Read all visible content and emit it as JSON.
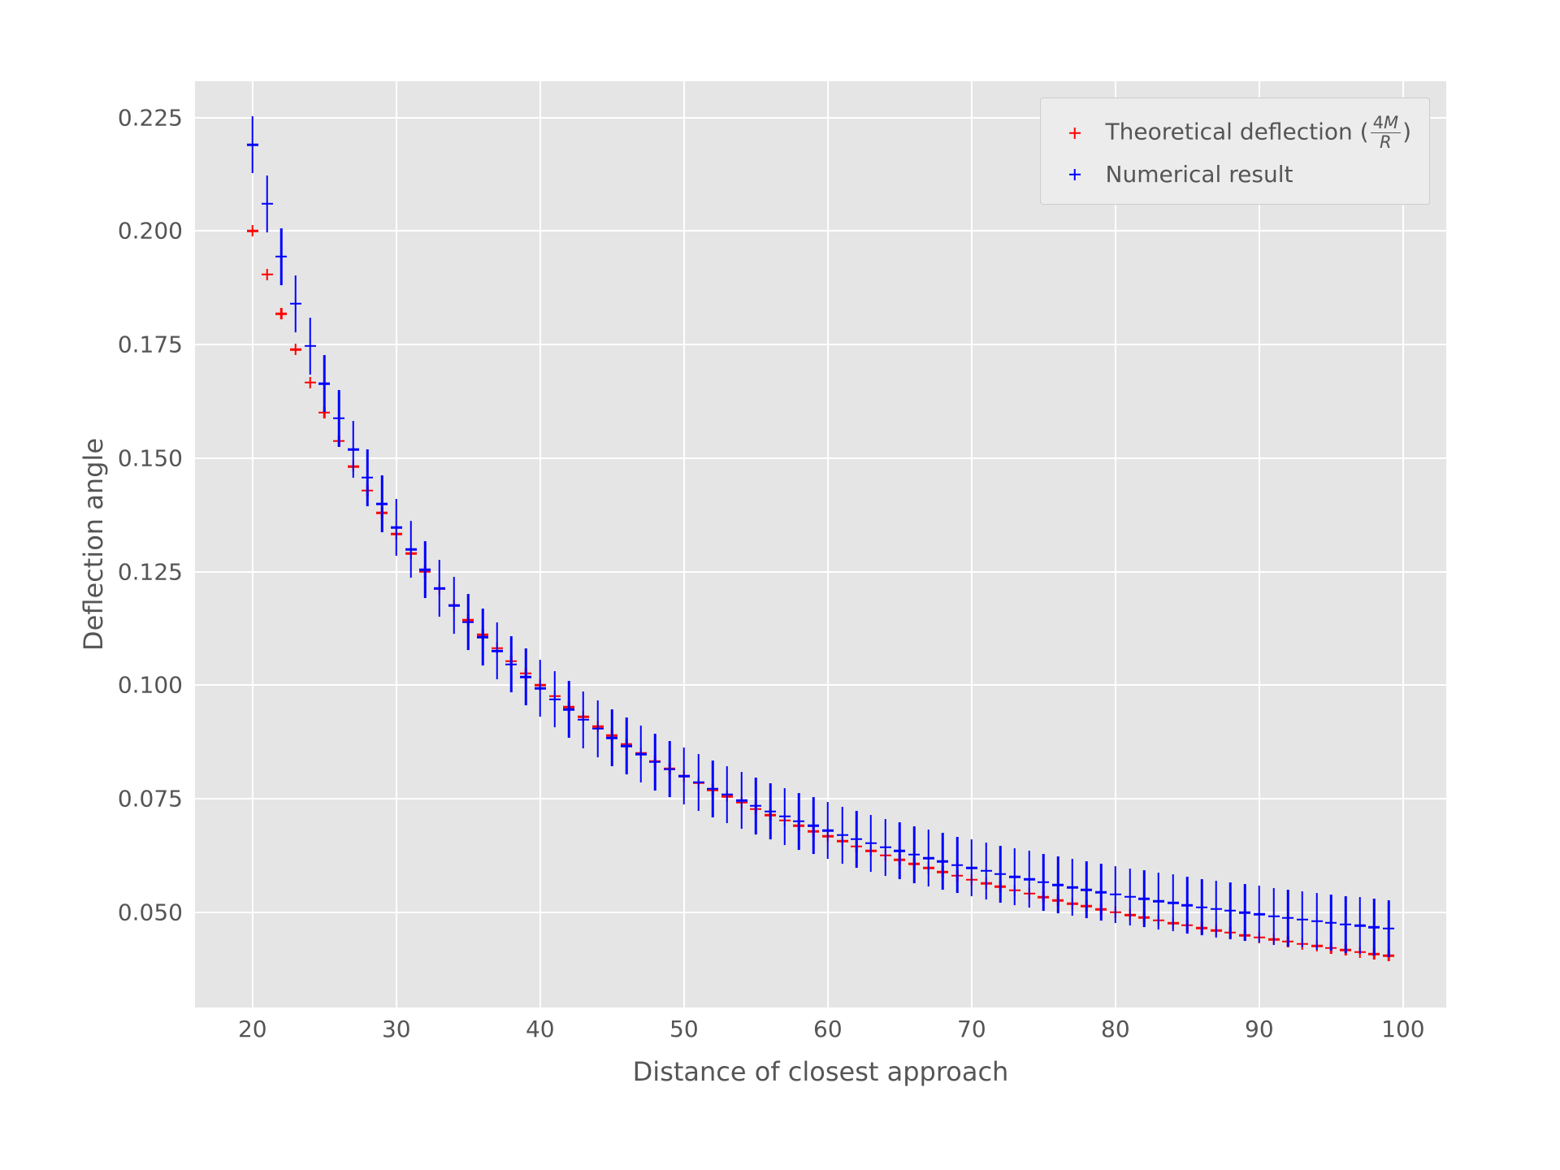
{
  "chart_data": {
    "type": "scatter",
    "xlabel": "Distance of closest approach",
    "ylabel": "Deflection angle",
    "xlim": [
      16,
      103
    ],
    "ylim": [
      0.029,
      0.233
    ],
    "xticks": [
      20,
      30,
      40,
      50,
      60,
      70,
      80,
      90,
      100
    ],
    "yticks": [
      0.05,
      0.075,
      0.1,
      0.125,
      0.15,
      0.175,
      0.2,
      0.225
    ],
    "x": [
      20,
      21,
      22,
      23,
      24,
      25,
      26,
      27,
      28,
      29,
      30,
      31,
      32,
      33,
      34,
      35,
      36,
      37,
      38,
      39,
      40,
      41,
      42,
      43,
      44,
      45,
      46,
      47,
      48,
      49,
      50,
      51,
      52,
      53,
      54,
      55,
      56,
      57,
      58,
      59,
      60,
      61,
      62,
      63,
      64,
      65,
      66,
      67,
      68,
      69,
      70,
      71,
      72,
      73,
      74,
      75,
      76,
      77,
      78,
      79,
      80,
      81,
      82,
      83,
      84,
      85,
      86,
      87,
      88,
      89,
      90,
      91,
      92,
      93,
      94,
      95,
      96,
      97,
      98,
      99
    ],
    "series": [
      {
        "name": "Theoretical deflection (4M/R)",
        "color": "#ff0000",
        "marker": "plus-short",
        "values": [
          0.2,
          0.1905,
          0.1818,
          0.1739,
          0.1667,
          0.16,
          0.1538,
          0.1481,
          0.1429,
          0.1379,
          0.1333,
          0.129,
          0.125,
          0.1212,
          0.1176,
          0.1143,
          0.1111,
          0.1081,
          0.1053,
          0.1026,
          0.1,
          0.0976,
          0.0952,
          0.093,
          0.0909,
          0.0889,
          0.087,
          0.0851,
          0.0833,
          0.0816,
          0.08,
          0.0784,
          0.0769,
          0.0755,
          0.0741,
          0.0727,
          0.0714,
          0.0702,
          0.069,
          0.0678,
          0.0667,
          0.0656,
          0.0645,
          0.0635,
          0.0625,
          0.0615,
          0.0606,
          0.0597,
          0.0588,
          0.058,
          0.0571,
          0.0563,
          0.0556,
          0.0548,
          0.0541,
          0.0533,
          0.0526,
          0.0519,
          0.0513,
          0.0506,
          0.05,
          0.0494,
          0.0488,
          0.0482,
          0.0476,
          0.0471,
          0.0465,
          0.046,
          0.0455,
          0.0449,
          0.0444,
          0.044,
          0.0435,
          0.043,
          0.0426,
          0.0421,
          0.0417,
          0.0412,
          0.0408,
          0.0404
        ]
      },
      {
        "name": "Numerical result",
        "color": "#0000ff",
        "marker": "plus-tall",
        "values": [
          0.219,
          0.206,
          0.1944,
          0.184,
          0.1747,
          0.1664,
          0.1588,
          0.1519,
          0.1457,
          0.1399,
          0.1347,
          0.1299,
          0.1254,
          0.1213,
          0.1175,
          0.1139,
          0.1106,
          0.1075,
          0.1046,
          0.1018,
          0.0993,
          0.0969,
          0.0946,
          0.0924,
          0.0904,
          0.0884,
          0.0866,
          0.0848,
          0.0831,
          0.0815,
          0.08,
          0.0786,
          0.0772,
          0.0759,
          0.0746,
          0.0734,
          0.0722,
          0.0711,
          0.07,
          0.069,
          0.068,
          0.067,
          0.0661,
          0.0652,
          0.0643,
          0.0635,
          0.0627,
          0.0619,
          0.0612,
          0.0604,
          0.0597,
          0.0591,
          0.0584,
          0.0578,
          0.0572,
          0.0566,
          0.056,
          0.0554,
          0.0549,
          0.0544,
          0.0539,
          0.0534,
          0.0529,
          0.0524,
          0.052,
          0.0515,
          0.0511,
          0.0507,
          0.0503,
          0.0499,
          0.0495,
          0.0491,
          0.0487,
          0.0484,
          0.048,
          0.0477,
          0.0473,
          0.047,
          0.0467,
          0.0464
        ],
        "yerr": 0.005
      }
    ],
    "legend": {
      "position": "upper right",
      "entries": [
        {
          "label_html": "Theoretical deflection (<span class=\"frac\"><span class=\"num\">4<i>M</i></span><span class=\"den\"><i>R</i></span></span>)"
        },
        {
          "label_html": "Numerical result"
        }
      ]
    }
  }
}
